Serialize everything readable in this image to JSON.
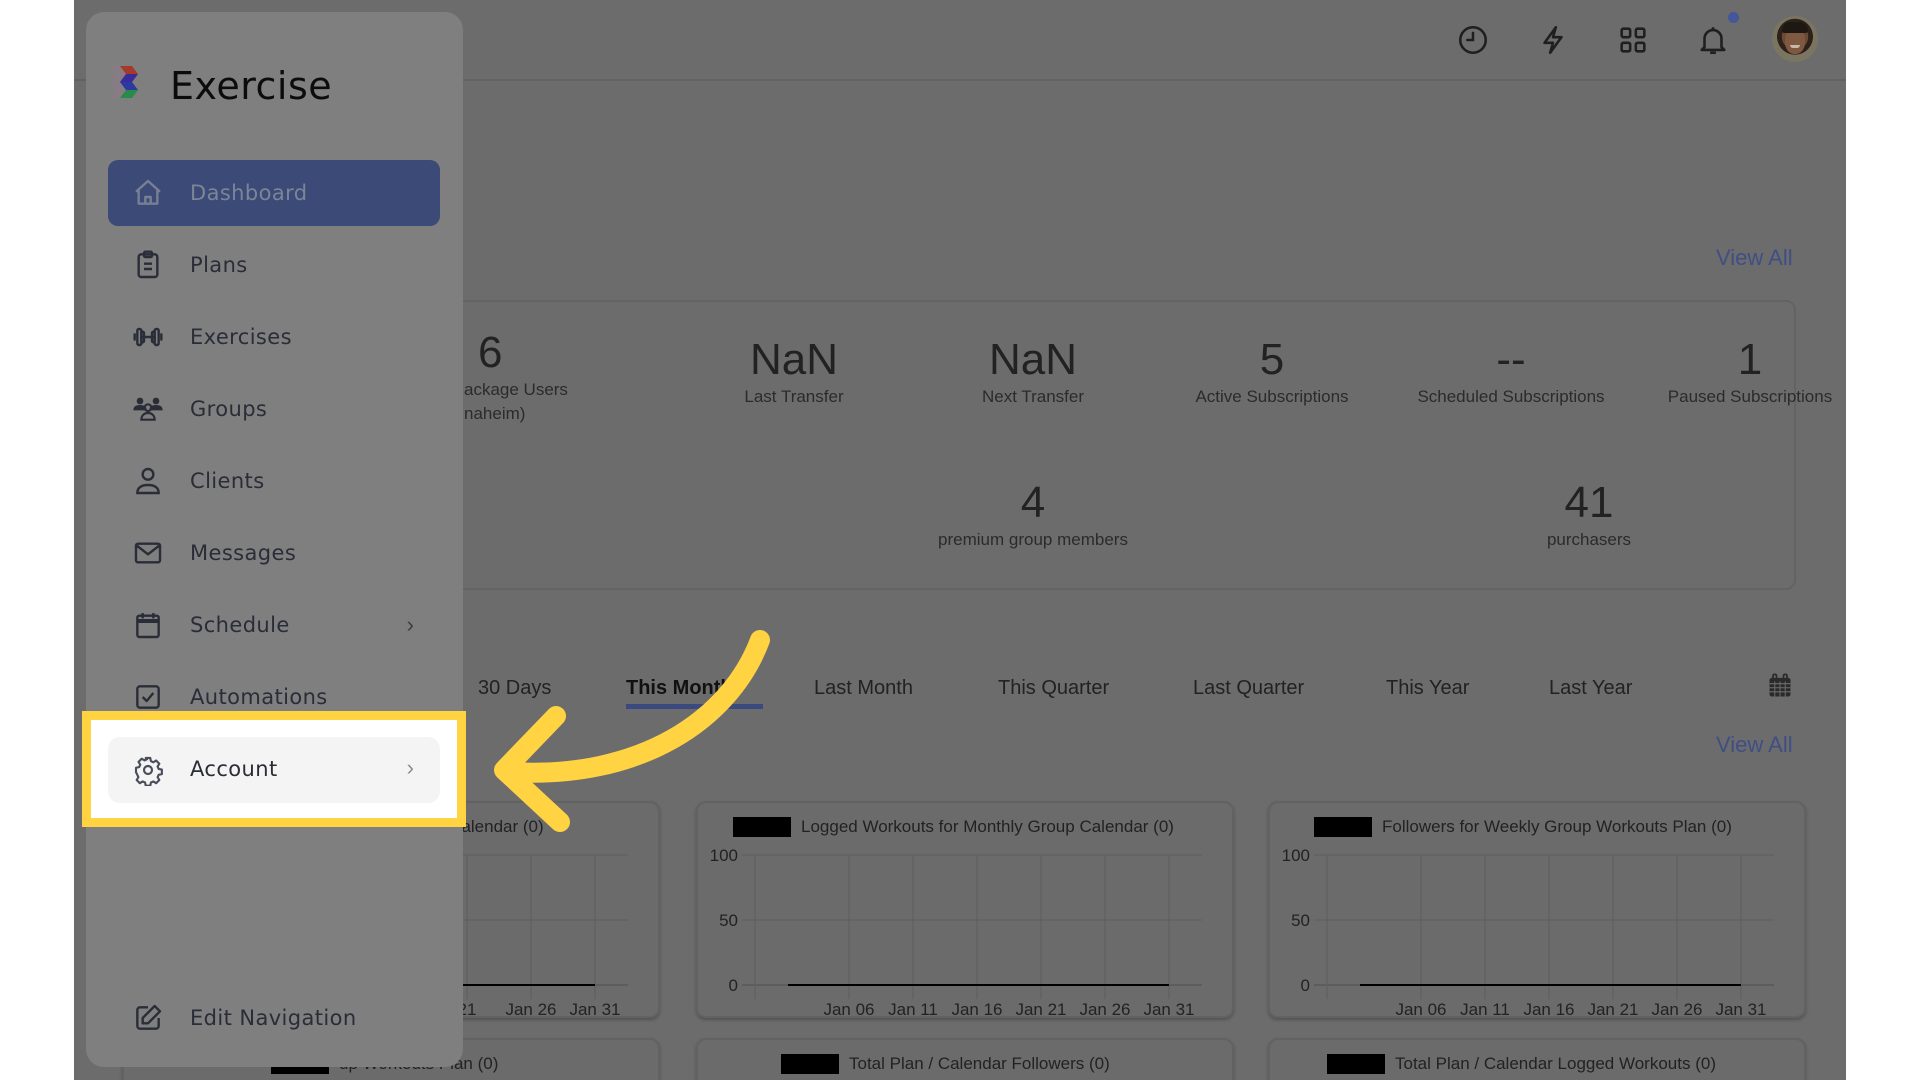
{
  "app": {
    "brand": "Exercise"
  },
  "topbar": {
    "icons": [
      "history-icon",
      "lightning-icon",
      "apps-grid-icon",
      "bell-icon"
    ],
    "has_notification": true,
    "avatar": "user-avatar"
  },
  "sidebar": {
    "items": [
      {
        "label": "Dashboard",
        "icon": "home-icon",
        "active": true
      },
      {
        "label": "Plans",
        "icon": "clipboard-icon"
      },
      {
        "label": "Exercises",
        "icon": "dumbbell-icon"
      },
      {
        "label": "Groups",
        "icon": "groups-icon"
      },
      {
        "label": "Clients",
        "icon": "user-icon"
      },
      {
        "label": "Messages",
        "icon": "envelope-icon"
      },
      {
        "label": "Schedule",
        "icon": "calendar-icon",
        "has_submenu": true
      },
      {
        "label": "Automations",
        "icon": "checkbox-icon"
      },
      {
        "label": "Account",
        "icon": "gear-icon",
        "has_submenu": true,
        "highlighted": true
      }
    ],
    "footer": {
      "label": "Edit Navigation",
      "icon": "edit-icon"
    }
  },
  "main": {
    "stats_view_all": "View All",
    "stats": [
      {
        "value": "6",
        "label": "ackage Users",
        "label2": "naheim)"
      },
      {
        "value": "NaN",
        "label": "Last Transfer"
      },
      {
        "value": "NaN",
        "label": "Next Transfer"
      },
      {
        "value": "5",
        "label": "Active Subscriptions"
      },
      {
        "value": "--",
        "label": "Scheduled Subscriptions"
      },
      {
        "value": "1",
        "label": "Paused Subscriptions"
      },
      {
        "value": "4",
        "label": "premium group members"
      },
      {
        "value": "41",
        "label": "purchasers"
      }
    ],
    "range_tabs": [
      "30 Days",
      "This Month",
      "Last Month",
      "This Quarter",
      "Last Quarter",
      "This Year",
      "Last Year"
    ],
    "active_tab": "This Month",
    "charts_view_all": "View All"
  },
  "chart_data": [
    {
      "type": "line",
      "title": "p Calendar (0)",
      "legend": "p Calendar (0)",
      "x": [
        "21",
        "Jan 26",
        "Jan 31"
      ],
      "yticks": [
        0,
        50,
        100
      ],
      "ylim": [
        0,
        100
      ],
      "series": [
        {
          "name": "p Calendar (0)",
          "values": [
            0,
            0,
            0
          ]
        }
      ],
      "grid": true
    },
    {
      "type": "line",
      "title": "Logged Workouts for Monthly Group Calendar (0)",
      "legend": "Logged Workouts for Monthly Group Calendar (0)",
      "x": [
        "Jan 06",
        "Jan 11",
        "Jan 16",
        "Jan 21",
        "Jan 26",
        "Jan 31"
      ],
      "yticks": [
        0,
        50,
        100
      ],
      "ylim": [
        0,
        100
      ],
      "series": [
        {
          "name": "Logged Workouts for Monthly Group Calendar (0)",
          "values": [
            0,
            0,
            0,
            0,
            0,
            0
          ]
        }
      ],
      "grid": true
    },
    {
      "type": "line",
      "title": "Followers for Weekly Group Workouts Plan (0)",
      "legend": "Followers for Weekly Group Workouts Plan (0)",
      "x": [
        "Jan 06",
        "Jan 11",
        "Jan 16",
        "Jan 21",
        "Jan 26",
        "Jan 31"
      ],
      "yticks": [
        0,
        50,
        100
      ],
      "ylim": [
        0,
        100
      ],
      "series": [
        {
          "name": "Followers for Weekly Group Workouts Plan (0)",
          "values": [
            0,
            0,
            0,
            0,
            0,
            0
          ]
        }
      ],
      "grid": true
    },
    {
      "type": "line",
      "title": "up Workouts Plan (0)",
      "legend": "up Workouts Plan (0)"
    },
    {
      "type": "line",
      "title": "Total Plan / Calendar Followers (0)",
      "legend": "Total Plan / Calendar Followers (0)"
    },
    {
      "type": "line",
      "title": "Total Plan / Calendar Logged Workouts (0)",
      "legend": "Total Plan / Calendar Logged Workouts (0)"
    }
  ],
  "annotation": {
    "type": "arrow",
    "color": "#ffd342",
    "target": "Account"
  }
}
